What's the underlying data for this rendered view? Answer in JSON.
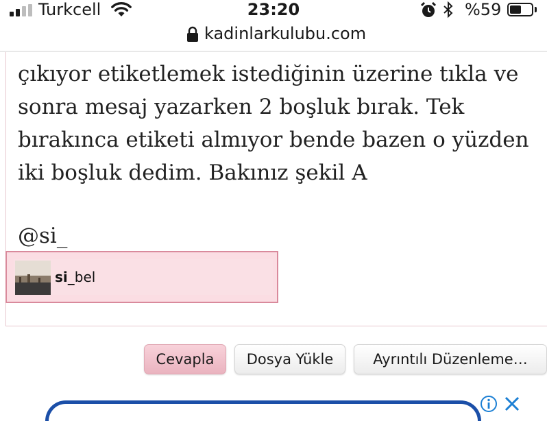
{
  "status_bar": {
    "carrier": "Turkcell",
    "time": "23:20",
    "battery_percent": "%59",
    "battery_level": 0.59,
    "signal_bars_filled": 2,
    "signal_bars_total": 4,
    "icons": [
      "signal-icon",
      "wifi-icon",
      "alarm-icon",
      "bluetooth-icon",
      "battery-icon"
    ]
  },
  "browser": {
    "url": "kadinlarkulubu.com",
    "icon": "lock-icon"
  },
  "post": {
    "lines": [
      "çıkıyor etiketlemek istediğinin üzerine tıkla ve",
      "sonra mesaj yazarken 2 boşluk bırak. Tek",
      "bırakınca etiketi almıyor bende bazen o yüzden",
      "iki boşluk dedim. Bakınız şekil A"
    ],
    "mention": "@si_"
  },
  "mention_suggestion": {
    "name_match": "si_",
    "name_rest": "bel"
  },
  "actions": {
    "reply": "Cevapla",
    "upload": "Dosya Yükle",
    "advanced": "Ayrıntılı Düzenleme…"
  },
  "ad": {
    "icons": [
      "info-icon",
      "close-icon"
    ]
  },
  "colors": {
    "accent_pink": "#fbdde3",
    "border_pink": "#d98a9c",
    "ad_blue": "#1b4fa8"
  }
}
